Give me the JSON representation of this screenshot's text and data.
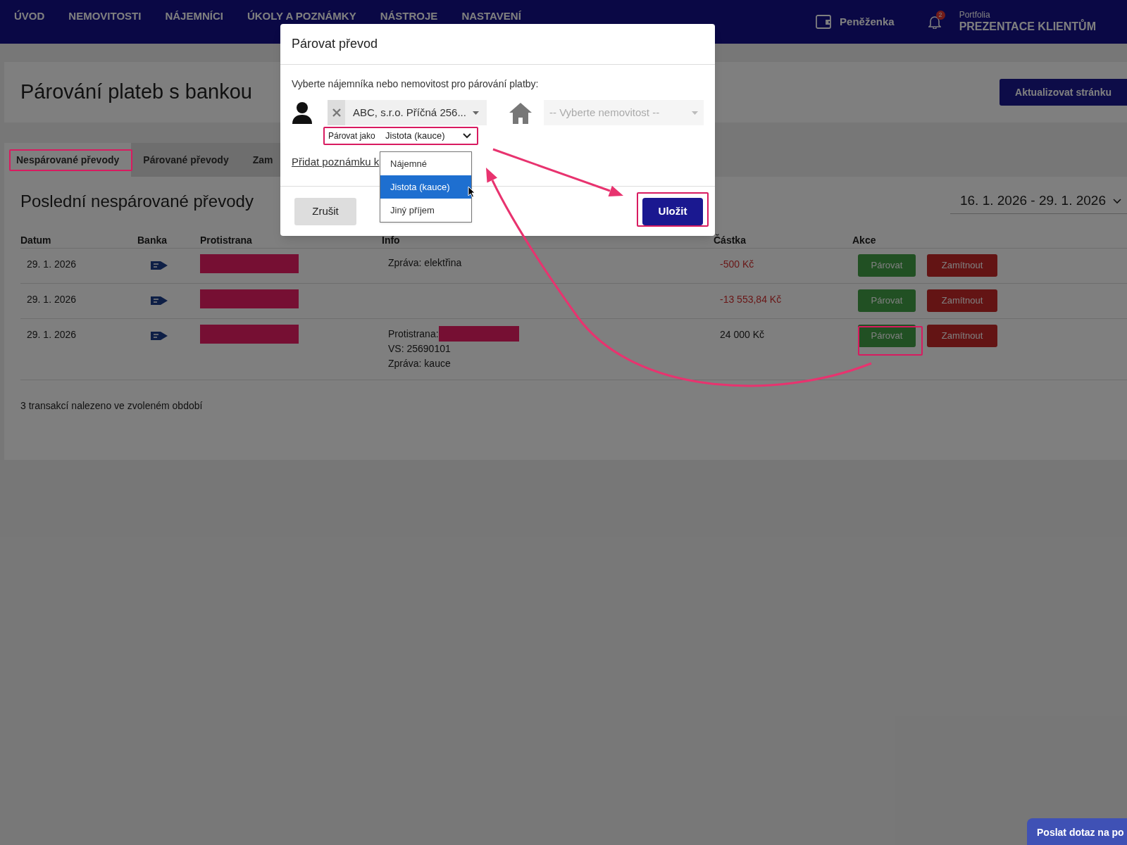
{
  "nav": {
    "items": [
      "ÚVOD",
      "NEMOVITOSTI",
      "NÁJEMNÍCI",
      "ÚKOLY A POZNÁMKY",
      "NÁSTROJE",
      "NASTAVENÍ"
    ],
    "wallet": "Peněženka",
    "notifications": "2",
    "portfolio_label": "Portfolia",
    "portfolio_name": "PREZENTACE KLIENTŮM"
  },
  "page_title": "Párování plateb s bankou",
  "refresh_button": "Aktualizovat stránku",
  "tabs": [
    {
      "label": "Nespárované převody",
      "selected": true
    },
    {
      "label": "Párované převody",
      "selected": false
    },
    {
      "label": "Zam",
      "selected": false
    }
  ],
  "section_title": "Poslední nespárované převody",
  "date_range": "16. 1. 2026 - 29. 1. 2026",
  "table": {
    "columns": [
      "Datum",
      "Banka",
      "Protistrana",
      "Info",
      "Částka",
      "Akce"
    ],
    "rows": [
      {
        "date": "29. 1. 2026",
        "counterparty_redacted": true,
        "info": [
          {
            "text": "Zpráva: elektřina",
            "redacted": false
          }
        ],
        "amount": "-500 Kč",
        "negative": true,
        "actions": [
          "Párovat",
          "Zamítnout"
        ]
      },
      {
        "date": "29. 1. 2026",
        "counterparty_redacted": true,
        "info": [],
        "amount": "-13 553,84 Kč",
        "negative": true,
        "actions": [
          "Párovat",
          "Zamítnout"
        ]
      },
      {
        "date": "29. 1. 2026",
        "counterparty_redacted": true,
        "info": [
          {
            "text": "Protistrana:",
            "redacted": true
          },
          {
            "text": "VS: 25690101",
            "redacted": false
          },
          {
            "text": "Zpráva: kauce",
            "redacted": false
          }
        ],
        "amount": "24 000 Kč",
        "negative": false,
        "actions": [
          "Párovat",
          "Zamítnout"
        ]
      }
    ]
  },
  "footer_text": "3 transakcí nalezeno ve zvoleném období",
  "dialog": {
    "title": "Párovat převod",
    "instruction": "Vyberte nájemníka nebo nemovitost pro párování platby:",
    "tenant_value": "ABC, s.r.o. Příčná 256...",
    "property_placeholder": "-- Vyberte nemovitost --",
    "pair_as_label": "Párovat jako",
    "pair_as_value": "Jistota (kauce)",
    "options": [
      {
        "label": "Nájemné",
        "selected": false
      },
      {
        "label": "Jistota (kauce)",
        "selected": true
      },
      {
        "label": "Jiný příjem",
        "selected": false
      }
    ],
    "note_link": "Přidat poznámku k",
    "cancel": "Zrušit",
    "save": "Uložit"
  },
  "chat_button": "Poslat dotaz na po"
}
